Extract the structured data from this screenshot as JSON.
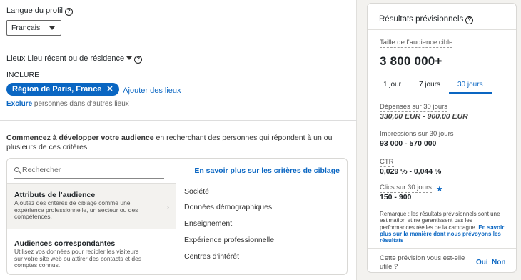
{
  "profile": {
    "language_label": "Langue du profil",
    "language_value": "Français"
  },
  "locations": {
    "label": "Lieux",
    "type_value": "Lieu récent ou de résidence",
    "include_label": "INCLURE",
    "chip": "Région de Paris, France",
    "add_label": "Ajouter des lieux",
    "exclude_link": "Exclure",
    "exclude_text": "personnes dans d’autres lieux"
  },
  "audience": {
    "intro_bold": "Commencez à développer votre audience",
    "intro_rest": "en recherchant des personnes qui répondent à un ou plusieurs de ces critères",
    "search_placeholder": "Rechercher",
    "learn_more": "En savoir plus sur les critères de ciblage",
    "categories": [
      {
        "title": "Attributs de l’audience",
        "desc": "Ajoutez des critères de ciblage comme une expérience professionnelle, un secteur ou des compétences."
      },
      {
        "title": "Audiences correspondantes",
        "desc": "Utilisez vos données pour recibler les visiteurs sur votre site web ou attirer des contacts et des comptes connus."
      }
    ],
    "subcategories": [
      "Société",
      "Données démographiques",
      "Enseignement",
      "Expérience professionnelle",
      "Centres d’intérêt"
    ]
  },
  "forecast": {
    "title": "Résultats prévisionnels",
    "audience_label": "Taille de l’audience cible",
    "audience_value": "3 800 000+",
    "tabs": [
      "1 jour",
      "7 jours",
      "30 jours"
    ],
    "active_tab": "30 jours",
    "spend_label": "Dépenses sur 30 jours",
    "spend_value": "330,00 EUR - 900,00 EUR",
    "impressions_label": "Impressions sur 30 jours",
    "impressions_value": "93 000 - 570 000",
    "ctr_label": "CTR",
    "ctr_value": "0,029 % - 0,044 %",
    "clicks_label": "Clics sur 30 jours",
    "clicks_value": "150 - 900",
    "note": "Remarque : les résultats prévisionnels sont une estimation et ne garantissent pas les performances réelles de la campagne.",
    "note_link": "En savoir plus sur la manière dont nous prévoyons les résultats",
    "feedback_question": "Cette prévision vous est-elle utile ?",
    "yes": "Oui",
    "no": "Non"
  },
  "colors": {
    "accent": "#0a66c2",
    "background": "#f3f2ef"
  }
}
